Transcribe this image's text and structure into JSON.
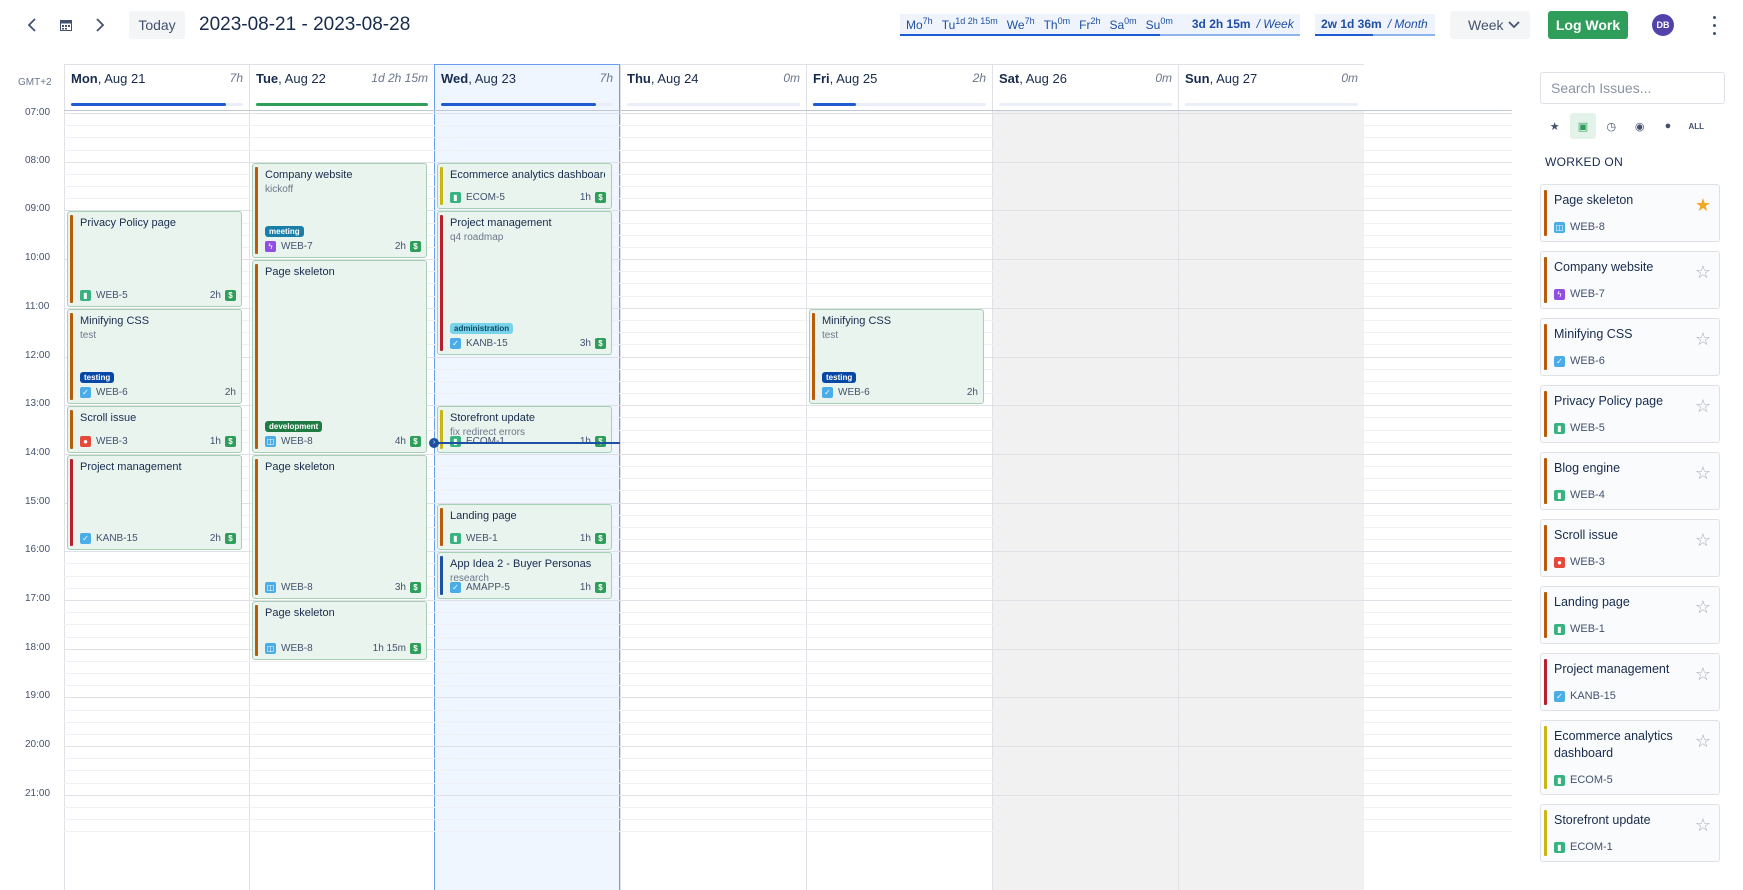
{
  "toolbar": {
    "today_label": "Today",
    "date_range": "2023-08-21 - 2023-08-28",
    "week_summary": {
      "days": [
        {
          "label": "Mo",
          "value": "7h"
        },
        {
          "label": "Tu",
          "value": "1d 2h 15m"
        },
        {
          "label": "We",
          "value": "7h"
        },
        {
          "label": "Th",
          "value": "0m"
        },
        {
          "label": "Fr",
          "value": "2h"
        },
        {
          "label": "Sa",
          "value": "0m"
        },
        {
          "label": "Su",
          "value": "0m"
        }
      ],
      "total": "3d 2h 15m",
      "period": "/ Week"
    },
    "month_summary": {
      "total": "2w 1d 36m",
      "period": "/ Month"
    },
    "view_label": "Week",
    "log_work_label": "Log Work",
    "avatar_initials": "DB"
  },
  "calendar": {
    "timezone": "GMT+2",
    "hours": [
      "07:00",
      "08:00",
      "09:00",
      "10:00",
      "11:00",
      "12:00",
      "13:00",
      "14:00",
      "15:00",
      "16:00",
      "17:00",
      "18:00",
      "19:00",
      "20:00",
      "21:00"
    ],
    "days": [
      {
        "dow": "Mon",
        "date": ", Aug 21",
        "total": "7h",
        "progress": 0.9,
        "bar_color": "#1f5ad1"
      },
      {
        "dow": "Tue",
        "date": ", Aug 22",
        "total": "1d 2h 15m",
        "progress": 1.0,
        "bar_color": "#2f9e5a"
      },
      {
        "dow": "Wed",
        "date": ", Aug 23",
        "total": "7h",
        "progress": 0.9,
        "bar_color": "#1f5ad1"
      },
      {
        "dow": "Thu",
        "date": ", Aug 24",
        "total": "0m",
        "progress": 0,
        "bar_color": "#1f5ad1"
      },
      {
        "dow": "Fri",
        "date": ", Aug 25",
        "total": "2h",
        "progress": 0.25,
        "bar_color": "#1f5ad1"
      },
      {
        "dow": "Sat",
        "date": ", Aug 26",
        "total": "0m",
        "progress": 0,
        "bar_color": "#1f5ad1"
      },
      {
        "dow": "Sun",
        "date": ", Aug 27",
        "total": "0m",
        "progress": 0,
        "bar_color": "#1f5ad1"
      }
    ],
    "events": [
      {
        "day": 0,
        "start": 9,
        "end": 11,
        "title": "Privacy Policy page",
        "note": "",
        "tag": "",
        "key": "WEB-5",
        "icon": "story",
        "dur": "2h",
        "billable": true,
        "stripe": "#b65c0a"
      },
      {
        "day": 0,
        "start": 11,
        "end": 13,
        "title": "Minifying CSS",
        "note": "test",
        "tag": "testing",
        "tag_color": "#0747a6",
        "key": "WEB-6",
        "icon": "task",
        "dur": "2h",
        "billable": false,
        "stripe": "#b65c0a"
      },
      {
        "day": 0,
        "start": 13,
        "end": 14,
        "title": "Scroll issue",
        "note": "",
        "tag": "",
        "key": "WEB-3",
        "icon": "bug",
        "dur": "1h",
        "billable": true,
        "stripe": "#b65c0a"
      },
      {
        "day": 0,
        "start": 14,
        "end": 16,
        "title": "Project management",
        "note": "",
        "tag": "",
        "key": "KANB-15",
        "icon": "task",
        "dur": "2h",
        "billable": true,
        "stripe": "#b8202f"
      },
      {
        "day": 1,
        "start": 8,
        "end": 10,
        "title": "Company website",
        "note": "kickoff",
        "tag": "meeting",
        "tag_color": "#1a7fa8",
        "key": "WEB-7",
        "icon": "epic",
        "dur": "2h",
        "billable": true,
        "stripe": "#b65c0a"
      },
      {
        "day": 1,
        "start": 10,
        "end": 14,
        "title": "Page skeleton",
        "note": "",
        "tag": "development",
        "tag_color": "#1f7a44",
        "key": "WEB-8",
        "icon": "subtask",
        "dur": "4h",
        "billable": true,
        "stripe": "#b65c0a"
      },
      {
        "day": 1,
        "start": 14,
        "end": 17,
        "title": "Page skeleton",
        "note": "",
        "tag": "",
        "key": "WEB-8",
        "icon": "subtask",
        "dur": "3h",
        "billable": true,
        "stripe": "#b65c0a"
      },
      {
        "day": 1,
        "start": 17,
        "end": 18.25,
        "title": "Page skeleton",
        "note": "",
        "tag": "",
        "key": "WEB-8",
        "icon": "subtask",
        "dur": "1h 15m",
        "billable": true,
        "stripe": "#b65c0a"
      },
      {
        "day": 2,
        "start": 8,
        "end": 9,
        "title": "Ecommerce analytics dashboard",
        "note": "",
        "tag": "",
        "key": "ECOM-5",
        "icon": "story",
        "dur": "1h",
        "billable": true,
        "stripe": "#c9b514"
      },
      {
        "day": 2,
        "start": 9,
        "end": 12,
        "title": "Project management",
        "note": "q4 roadmap",
        "tag": "administration",
        "tag_color": "#79d3ea",
        "tag_text": "#0b4a66",
        "key": "KANB-15",
        "icon": "task",
        "dur": "3h",
        "billable": true,
        "stripe": "#b8202f"
      },
      {
        "day": 2,
        "start": 13,
        "end": 14,
        "title": "Storefront update",
        "note": "fix redirect errors",
        "tag": "",
        "key": "ECOM-1",
        "icon": "story",
        "dur": "1h",
        "billable": true,
        "stripe": "#c9b514"
      },
      {
        "day": 2,
        "start": 15,
        "end": 16,
        "title": "Landing page",
        "note": "",
        "tag": "",
        "key": "WEB-1",
        "icon": "story",
        "dur": "1h",
        "billable": true,
        "stripe": "#b65c0a"
      },
      {
        "day": 2,
        "start": 16,
        "end": 17,
        "title": "App Idea 2 - Buyer Personas",
        "note": "research",
        "tag": "",
        "key": "AMAPP-5",
        "icon": "task",
        "dur": "1h",
        "billable": true,
        "stripe": "#1f4fa3"
      },
      {
        "day": 4,
        "start": 11,
        "end": 13,
        "title": "Minifying CSS",
        "note": "test",
        "tag": "testing",
        "tag_color": "#0747a6",
        "key": "WEB-6",
        "icon": "task",
        "dur": "2h",
        "billable": false,
        "stripe": "#b65c0a"
      }
    ],
    "now": {
      "day": 2,
      "hour": 13.75
    }
  },
  "sidebar": {
    "search_placeholder": "Search Issues...",
    "filters": [
      {
        "name": "star-filter-icon",
        "glyph": "★",
        "active": false
      },
      {
        "name": "briefcase-filter-icon",
        "glyph": "▣",
        "active": true
      },
      {
        "name": "clock-filter-icon",
        "glyph": "◷",
        "active": false
      },
      {
        "name": "eye-filter-icon",
        "glyph": "◉",
        "active": false
      },
      {
        "name": "user-filter-icon",
        "glyph": "●",
        "active": false
      },
      {
        "name": "all-filter",
        "glyph": "ALL",
        "active": false
      }
    ],
    "section_title": "WORKED ON",
    "cards": [
      {
        "title": "Page skeleton",
        "key": "WEB-8",
        "icon": "subtask",
        "stripe": "#b65c0a",
        "starred": true,
        "h": 58
      },
      {
        "title": "Company website",
        "key": "WEB-7",
        "icon": "epic",
        "stripe": "#b65c0a",
        "starred": false,
        "h": 58
      },
      {
        "title": "Minifying CSS",
        "key": "WEB-6",
        "icon": "task",
        "stripe": "#b65c0a",
        "starred": false,
        "h": 58
      },
      {
        "title": "Privacy Policy page",
        "key": "WEB-5",
        "icon": "story",
        "stripe": "#b65c0a",
        "starred": false,
        "h": 58
      },
      {
        "title": "Blog engine",
        "key": "WEB-4",
        "icon": "story",
        "stripe": "#b65c0a",
        "starred": false,
        "h": 58
      },
      {
        "title": "Scroll issue",
        "key": "WEB-3",
        "icon": "bug",
        "stripe": "#b65c0a",
        "starred": false,
        "h": 58
      },
      {
        "title": "Landing page",
        "key": "WEB-1",
        "icon": "story",
        "stripe": "#b65c0a",
        "starred": false,
        "h": 58
      },
      {
        "title": "Project management",
        "key": "KANB-15",
        "icon": "task",
        "stripe": "#b8202f",
        "starred": false,
        "h": 58
      },
      {
        "title": "Ecommerce analytics dashboard",
        "key": "ECOM-5",
        "icon": "story",
        "stripe": "#c9b514",
        "starred": false,
        "h": 75
      },
      {
        "title": "Storefront update",
        "key": "ECOM-1",
        "icon": "story",
        "stripe": "#c9b514",
        "starred": false,
        "h": 58
      }
    ]
  },
  "colors": {
    "icon_story": "#36b37e",
    "icon_task": "#4bade8",
    "icon_bug": "#e5493a",
    "icon_epic": "#904ee2",
    "icon_subtask": "#4bade8"
  }
}
